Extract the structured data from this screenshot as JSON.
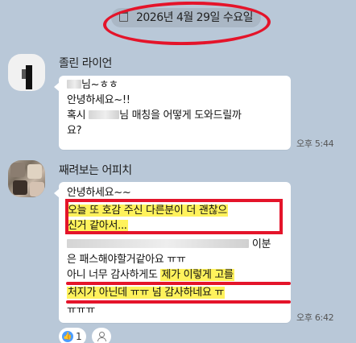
{
  "date_banner": {
    "text": "2026년 4월 29일 수요일",
    "icon": "calendar-icon"
  },
  "messages": [
    {
      "sender": "졸린 라이언",
      "time": "오후 5:44",
      "lines": [
        {
          "parts": [
            {
              "type": "blur"
            },
            {
              "type": "text",
              "value": "님~ㅎㅎ"
            }
          ]
        },
        {
          "parts": [
            {
              "type": "text",
              "value": "안녕하세요~!!"
            }
          ]
        },
        {
          "parts": [
            {
              "type": "text",
              "value": "혹시 "
            },
            {
              "type": "blur"
            },
            {
              "type": "text",
              "value": "님 매칭을 어떻게 도와드릴까"
            }
          ]
        },
        {
          "parts": [
            {
              "type": "text",
              "value": "요?"
            }
          ]
        }
      ]
    },
    {
      "sender": "째려보는 어피치",
      "time": "오후 6:42",
      "lines": [
        {
          "parts": [
            {
              "type": "text",
              "value": "안녕하세요~~"
            }
          ]
        },
        {
          "parts": [
            {
              "type": "highlight",
              "value": "오늘 또 호감 주신 다른분이 더 괜찮으"
            }
          ]
        },
        {
          "parts": [
            {
              "type": "highlight",
              "value": "신거 같아서..."
            }
          ]
        },
        {
          "parts": [
            {
              "type": "blur"
            },
            {
              "type": "text",
              "value": " 이분"
            }
          ]
        },
        {
          "parts": [
            {
              "type": "text",
              "value": "은 패스해야할거같아요 ㅠㅠ"
            }
          ]
        },
        {
          "parts": [
            {
              "type": "text",
              "value": "아니 너무 감사하게도 "
            },
            {
              "type": "highlight",
              "value": "제가 이렇게 고를"
            }
          ]
        },
        {
          "parts": [
            {
              "type": "highlight",
              "value": "처지가 아닌데 ㅠㅠ 넘 감사하네요 ㅠ"
            }
          ]
        },
        {
          "parts": [
            {
              "type": "text",
              "value": "ㅠㅠㅠ"
            }
          ]
        }
      ]
    }
  ],
  "reactions": {
    "like_count": "1",
    "like_icon": "thumbs-up-icon",
    "add_icon": "person-icon"
  },
  "colors": {
    "background": "#b9c8d8",
    "bubble": "#ffffff",
    "highlight": "#fff25c",
    "annotation": "#e4142a"
  }
}
